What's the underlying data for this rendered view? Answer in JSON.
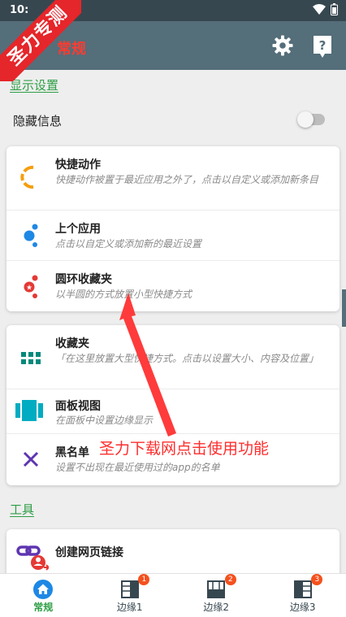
{
  "status_bar": {
    "time": "10:"
  },
  "watermark": {
    "text": "圣力专测"
  },
  "app_bar": {
    "title": "常规"
  },
  "sections": {
    "display_settings": "显示设置",
    "tools": "工具"
  },
  "hide_info": {
    "label": "隐藏信息",
    "enabled": false
  },
  "card1": [
    {
      "title": "快捷动作",
      "desc": "快捷动作被置于最近应用之外了，点击以自定义或添加新条目"
    },
    {
      "title": "上个应用",
      "desc": "点击以自定义或添加新的最近设置"
    },
    {
      "title": "圆环收藏夹",
      "desc": "以半圆的方式放置小型快捷方式"
    }
  ],
  "card2": [
    {
      "title": "收藏夹",
      "desc": "「在这里放置大型快捷方式。点击以设置大小、内容及位置」"
    },
    {
      "title": "面板视图",
      "desc": "在面板中设置边缘显示"
    },
    {
      "title": "黑名单",
      "desc": "设置不出现在最近使用过的app的名单"
    }
  ],
  "card3": {
    "title": "创建网页链接"
  },
  "overlay": {
    "text": "圣力下载网点击使用功能"
  },
  "bottom_nav": [
    {
      "label": "常规",
      "badge": ""
    },
    {
      "label": "边缘1",
      "badge": "1"
    },
    {
      "label": "边缘2",
      "badge": "2"
    },
    {
      "label": "边缘3",
      "badge": "3"
    }
  ],
  "colors": {
    "accent": "#2e9e45",
    "appbar": "#546e7a",
    "statusbar": "#37474f",
    "overlay_red": "#ff2d2d",
    "badge": "#f4511e"
  }
}
